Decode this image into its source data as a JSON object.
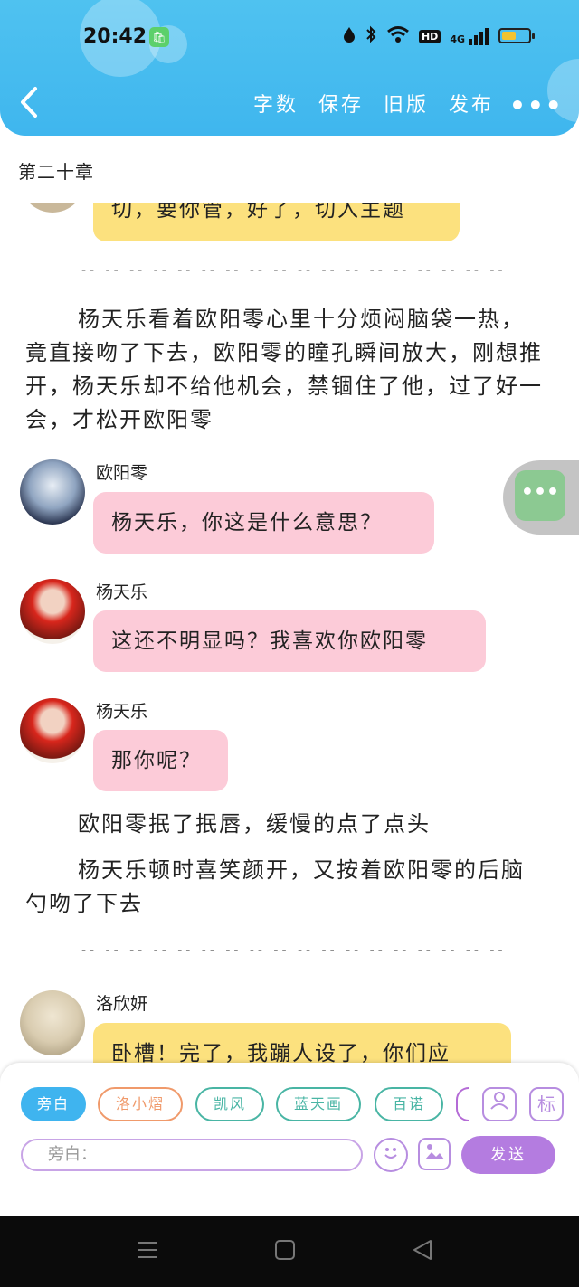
{
  "status_bar": {
    "time": "20:42",
    "app_icon": "shopping-bag-icon",
    "icons": [
      "drop-icon",
      "bluetooth-icon",
      "wifi-icon",
      "hd-icon",
      "4g-signal-icon",
      "battery-icon"
    ],
    "hd_label": "HD",
    "network_label": "4G",
    "battery_level": 0.55
  },
  "header": {
    "back_icon": "back-arrow-icon",
    "actions": [
      "字数",
      "保存",
      "旧版",
      "发布"
    ],
    "more_icon": "more-icon",
    "colors": {
      "header": "#4fc2f0"
    }
  },
  "chapter_title": "第二十章",
  "story": {
    "top_bubble_text": "切，要你管，好了，切入主题",
    "divider": "-- -- -- -- -- -- -- -- -- -- -- -- -- -- -- -- -- --",
    "para1": "杨天乐看着欧阳零心里十分烦闷脑袋一热，竟直接吻了下去，欧阳零的瞳孔瞬间放大，刚想推开，杨天乐却不给他机会，禁锢住了他，过了好一会，才松开欧阳零",
    "messages": [
      {
        "name": "欧阳零",
        "text": "杨天乐，你这是什么意思？"
      },
      {
        "name": "杨天乐",
        "text": "这还不明显吗？我喜欢你欧阳零"
      },
      {
        "name": "杨天乐",
        "text": "那你呢？"
      }
    ],
    "para2": "欧阳零抿了抿唇，缓慢的点了点头",
    "para3": "杨天乐顿时喜笑颜开，又按着欧阳零的后脑勺吻了下去",
    "last_message": {
      "name": "洛欣妍",
      "text": "卧槽！完了，我蹦人设了，你们应"
    }
  },
  "float_button": {
    "icon": "more-dots-icon"
  },
  "composer": {
    "roles": [
      "旁白",
      "洛小熠",
      "凯风",
      "蓝天画",
      "百诺"
    ],
    "placeholder": "旁白：",
    "send_label": "发送",
    "tag_label": "标",
    "icons": [
      "role-card-icon",
      "tag-icon",
      "emoji-icon",
      "image-icon"
    ]
  },
  "nav_bar": {
    "icons": [
      "menu-icon",
      "home-icon",
      "back-icon"
    ]
  }
}
